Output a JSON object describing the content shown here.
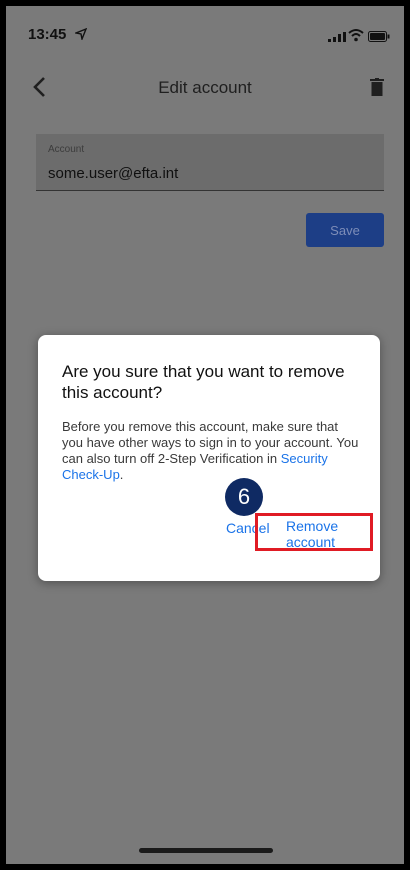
{
  "status_bar": {
    "time": "13:45",
    "icons": [
      "location-icon",
      "signal-icon",
      "wifi-icon",
      "battery-icon"
    ]
  },
  "app_bar": {
    "title": "Edit account",
    "back_icon": "chevron-left-icon",
    "delete_icon": "trash-icon"
  },
  "account_field": {
    "label": "Account",
    "value": "some.user@efta.int"
  },
  "save_button": {
    "label": "Save"
  },
  "dialog": {
    "title": "Are you sure that you want to remove this account?",
    "body": "Before you remove this account, make sure that you have other ways to sign in to your account. You can also turn off 2-Step Verification in ",
    "link": "Security Check-Up",
    "link_suffix": ".",
    "cancel_label": "Cancel",
    "remove_label": "Remove account"
  },
  "annotation": {
    "step_number": "6"
  },
  "colors": {
    "overlay": "#7a7a7a",
    "link_blue": "#1a73e8",
    "save_button_bg": "#1d3e86",
    "highlight_red": "#e01b24",
    "badge_navy": "#0f2a63"
  }
}
